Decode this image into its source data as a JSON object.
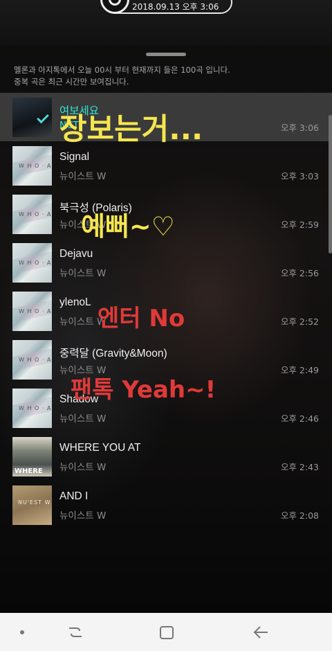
{
  "status": {
    "datetime": "2018.09.13 오후 3:06"
  },
  "sheet": {
    "info_line1": "멜론과 아지톡에서 오늘 00시 부터 현재까지 들은 100곡 입니다.",
    "info_line2": "중복 곡은 최근 시간만 보여집니다."
  },
  "tracks": [
    {
      "title": "여보세요",
      "artist": "NCT",
      "time": "오후 3:06",
      "selected": true
    },
    {
      "title": "Signal",
      "artist": "뉴이스트 W",
      "time": "오후 3:03"
    },
    {
      "title": "북극성 (Polaris)",
      "artist": "뉴이스트 W",
      "time": "오후 2:59"
    },
    {
      "title": "Dejavu",
      "artist": "뉴이스트 W",
      "time": "오후 2:56"
    },
    {
      "title": "ylenoL",
      "artist": "뉴이스트 W",
      "time": "오후 2:52"
    },
    {
      "title": "중력달 (Gravity&Moon)",
      "artist": "뉴이스트 W",
      "time": "오후 2:49"
    },
    {
      "title": "Shadow",
      "artist": "뉴이스트 W",
      "time": "오후 2:46"
    },
    {
      "title": "WHERE YOU AT",
      "artist": "뉴이스트 W",
      "time": "오후 2:43"
    },
    {
      "title": "AND I",
      "artist": "뉴이스트 W",
      "time": "오후 2:08"
    }
  ],
  "overlay": {
    "caption1": "장보는거...",
    "caption2": "예뻐~♡",
    "caption3": "엔터 No",
    "caption4": "팬톡 Yeah~!"
  },
  "icons": {
    "record": "record-icon",
    "check": "check-icon",
    "nav_recent": "recent-apps-icon",
    "nav_home": "home-icon",
    "nav_back": "back-icon"
  },
  "colors": {
    "accent_selected": "#2ee8d6",
    "caption_yellow": "#f4e64f",
    "caption_red": "#e03a38"
  }
}
